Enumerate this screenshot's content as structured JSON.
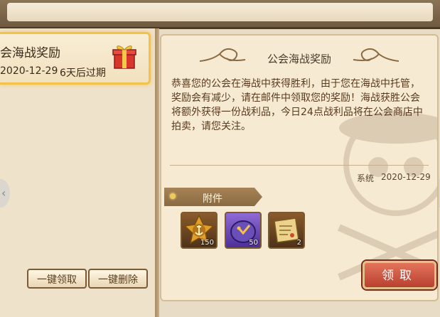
{
  "mail_list": {
    "items": [
      {
        "title": "会海战奖励",
        "date": "2020-12-29",
        "expire": "6天后过期"
      }
    ],
    "buttons": {
      "claim_all": "一键领取",
      "delete_all": "一键删除"
    }
  },
  "mail": {
    "title": "公会海战奖励",
    "body": "恭喜您的公会在海战中获得胜利，由于您在海战中托管，奖励会有减少，请在邮件中领取您的奖励！海战获胜公会将额外获得一份战利品，今日24点战利品将在公会商店中拍卖，请您关注。",
    "sender": "系统",
    "date": "2020-12-29",
    "attachments_label": "附件",
    "attachments": [
      {
        "icon": "anchor-medal-icon",
        "qty": "150"
      },
      {
        "icon": "purple-gem-icon",
        "qty": "50"
      },
      {
        "icon": "treasure-map-icon",
        "qty": "2"
      }
    ],
    "claim_label": "领取"
  },
  "colors": {
    "highlight": "#f2c24b",
    "claim": "#c9513c",
    "text": "#5a3a1f"
  }
}
